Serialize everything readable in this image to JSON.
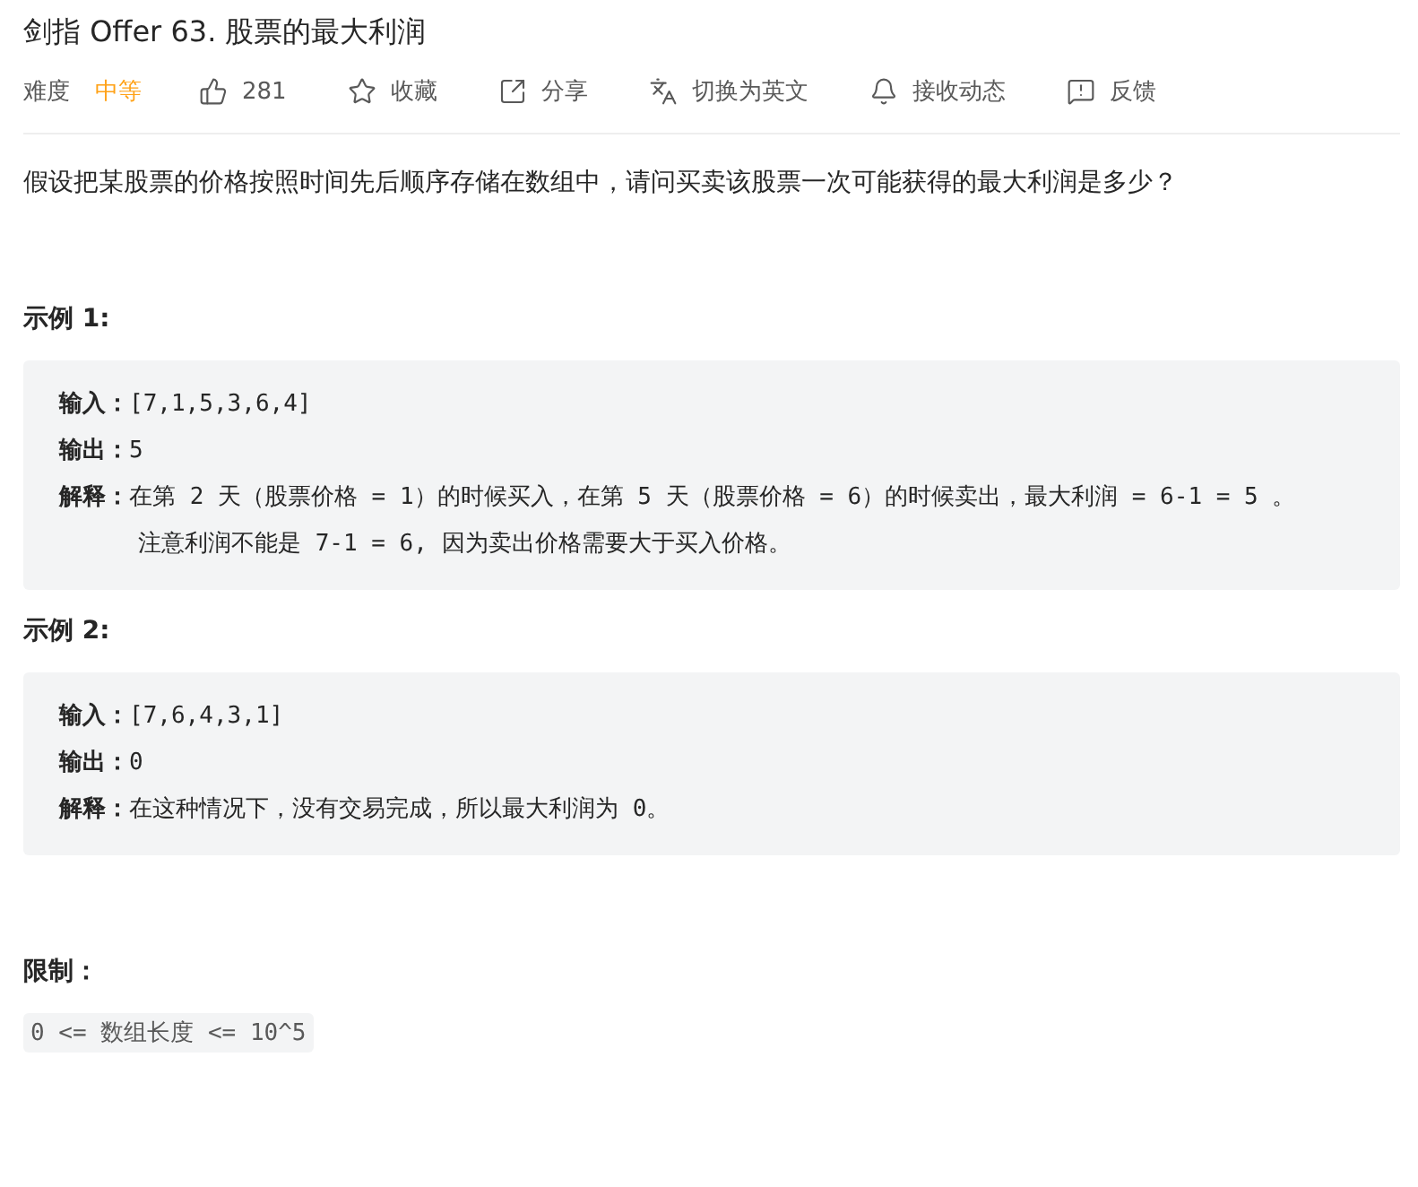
{
  "title": "剑指 Offer 63. 股票的最大利润",
  "meta": {
    "difficulty_label": "难度",
    "difficulty": "中等",
    "actions": [
      {
        "kind": "like",
        "label": "281"
      },
      {
        "kind": "star",
        "label": "收藏"
      },
      {
        "kind": "share",
        "label": "分享"
      },
      {
        "kind": "translate",
        "label": "切换为英文"
      },
      {
        "kind": "bell",
        "label": "接收动态"
      },
      {
        "kind": "feedback",
        "label": "反馈"
      }
    ]
  },
  "description": "假设把某股票的价格按照时间先后顺序存储在数组中，请问买卖该股票一次可能获得的最大利润是多少？",
  "examples": [
    {
      "heading": "示例 1:",
      "lines": [
        {
          "kind": "field",
          "text": "**输入：**[7,1,5,3,6,4]"
        },
        {
          "kind": "field",
          "text": "**输出：**5"
        },
        {
          "kind": "field",
          "text": "**解释：**在第 2 天（股票价格 = 1）的时候买入，在第 5 天（股票价格 = 6）的时候卖出，最大利润 = 6-1 = 5 。"
        },
        {
          "kind": "note",
          "text": "注意利润不能是 7-1 = 6, 因为卖出价格需要大于买入价格。"
        }
      ]
    },
    {
      "heading": "示例 2:",
      "lines": [
        {
          "kind": "field",
          "text": "**输入：**[7,6,4,3,1]"
        },
        {
          "kind": "field",
          "text": "**输出：**0"
        },
        {
          "kind": "field",
          "text": "**解释：**在这种情况下，没有交易完成，所以最大利润为 0。"
        }
      ]
    }
  ],
  "constraints": {
    "heading": "限制：",
    "items": [
      "0 <= 数组长度 <= 10^5"
    ]
  }
}
